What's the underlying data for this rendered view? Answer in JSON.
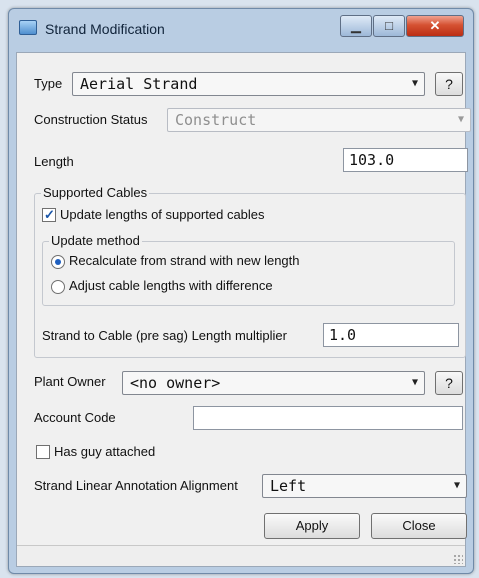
{
  "window": {
    "title": "Strand Modification"
  },
  "type": {
    "label": "Type",
    "value": "Aerial Strand",
    "help": "?"
  },
  "construction_status": {
    "label": "Construction Status",
    "value": "Construct"
  },
  "length": {
    "label": "Length",
    "value": "103.0"
  },
  "supported_cables": {
    "label": "Supported Cables",
    "update_lengths_label": "Update lengths of supported cables",
    "update_lengths_checked": true,
    "update_method": {
      "label": "Update method",
      "options": [
        {
          "label": "Recalculate from strand with new length",
          "selected": true
        },
        {
          "label": "Adjust cable lengths with difference",
          "selected": false
        }
      ]
    },
    "multiplier_label": "Strand to Cable (pre sag) Length multiplier",
    "multiplier_value": "1.0"
  },
  "plant_owner": {
    "label": "Plant Owner",
    "value": "<no owner>",
    "help": "?"
  },
  "account_code": {
    "label": "Account Code",
    "value": ""
  },
  "has_guy": {
    "label": "Has guy attached",
    "checked": false
  },
  "annotation_alignment": {
    "label": "Strand Linear Annotation Alignment",
    "value": "Left"
  },
  "buttons": {
    "apply": "Apply",
    "close": "Close"
  },
  "icons": [
    "window-app-icon",
    "minimize-icon",
    "maximize-icon",
    "close-icon",
    "dropdown-arrow-icon",
    "resize-grip-icon"
  ]
}
